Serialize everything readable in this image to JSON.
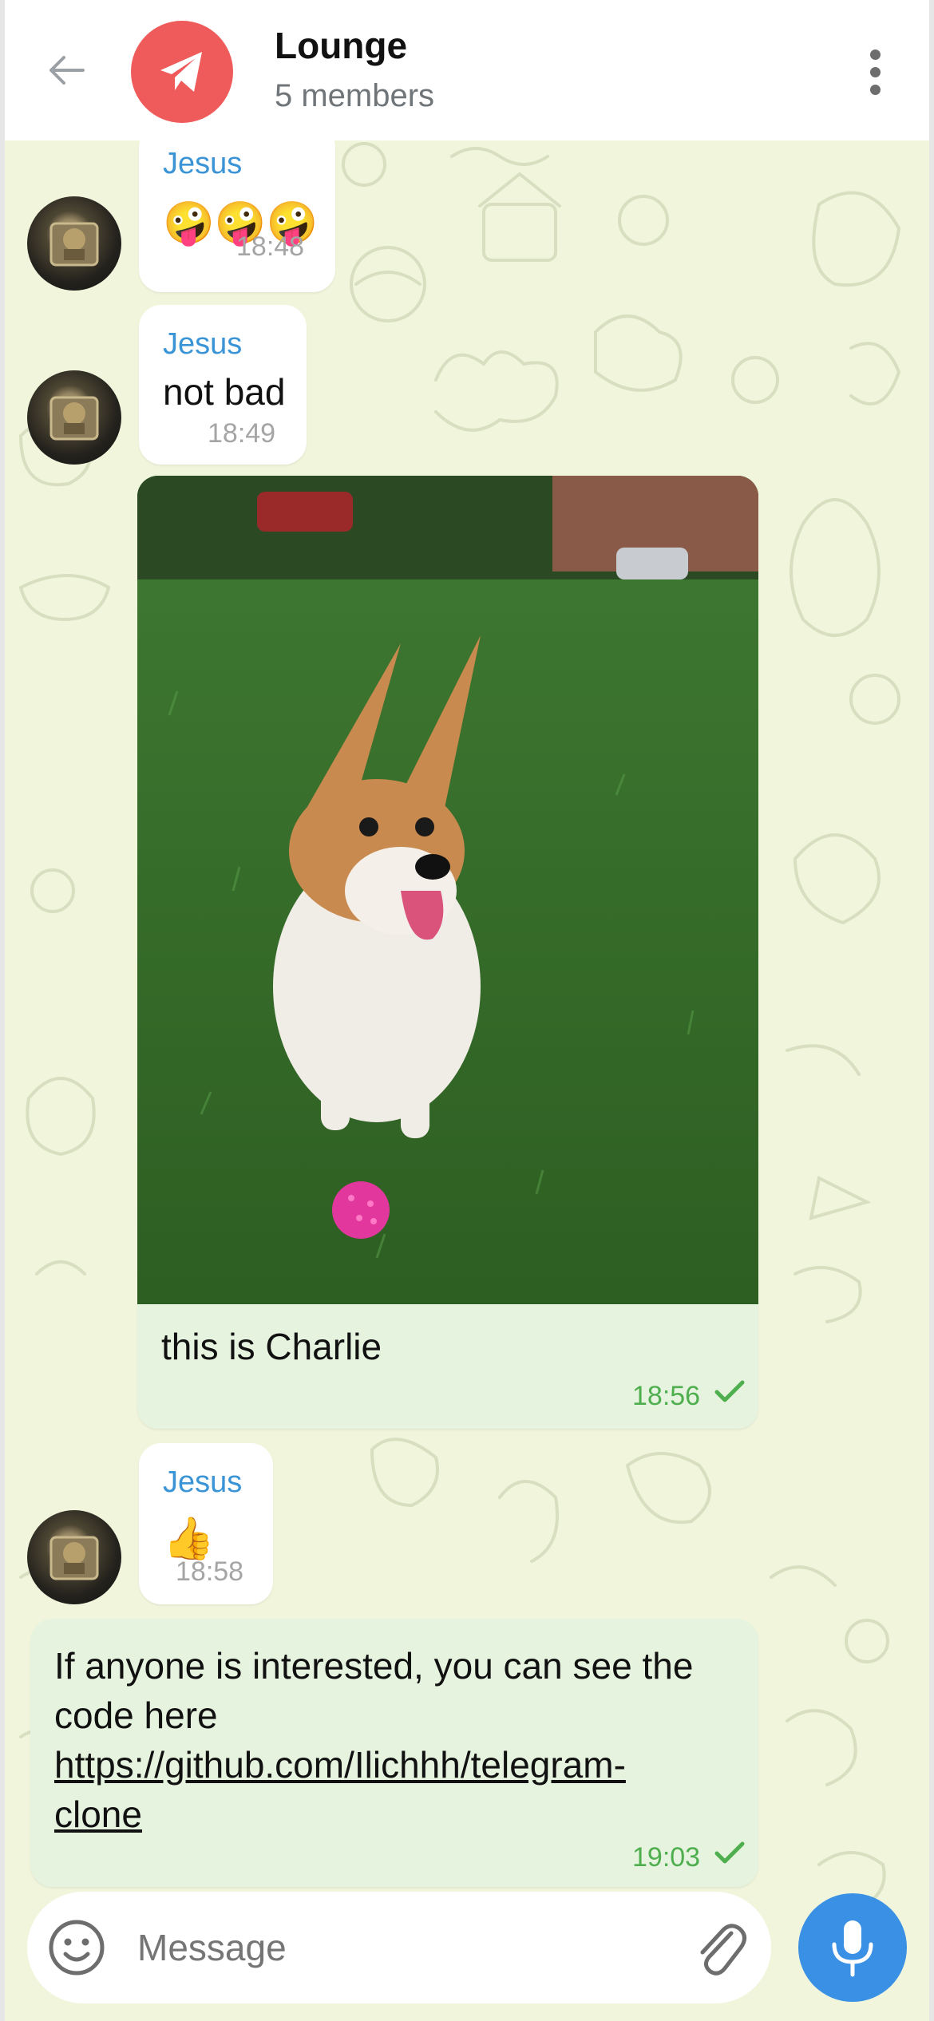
{
  "header": {
    "title": "Lounge",
    "subtitle": "5 members",
    "avatar_color": "#ef5b5b"
  },
  "messages": [
    {
      "id": 1,
      "sender": "Jesus",
      "type": "emoji",
      "content": "🤪🤪🤪",
      "time": "18:48",
      "direction": "in"
    },
    {
      "id": 2,
      "sender": "Jesus",
      "type": "text",
      "content": "not bad",
      "time": "18:49",
      "direction": "in"
    },
    {
      "id": 3,
      "type": "photo",
      "caption": "this is Charlie",
      "time": "18:56",
      "direction": "out",
      "status": "read"
    },
    {
      "id": 4,
      "sender": "Jesus",
      "type": "emoji",
      "content": "👍",
      "time": "18:58",
      "direction": "in"
    },
    {
      "id": 5,
      "type": "text",
      "line1": "If anyone is interested, you can see the",
      "line2": "code here",
      "link_line1": "https://github.com/Ilichhh/telegram-",
      "link_line2": "clone",
      "time": "19:03",
      "direction": "out",
      "status": "read"
    }
  ],
  "input": {
    "placeholder": "Message"
  },
  "colors": {
    "accent": "#3a90e4",
    "sender_name": "#3a94d6",
    "outgoing_bubble": "#e6f3df",
    "checkmark": "#4fae4e"
  }
}
